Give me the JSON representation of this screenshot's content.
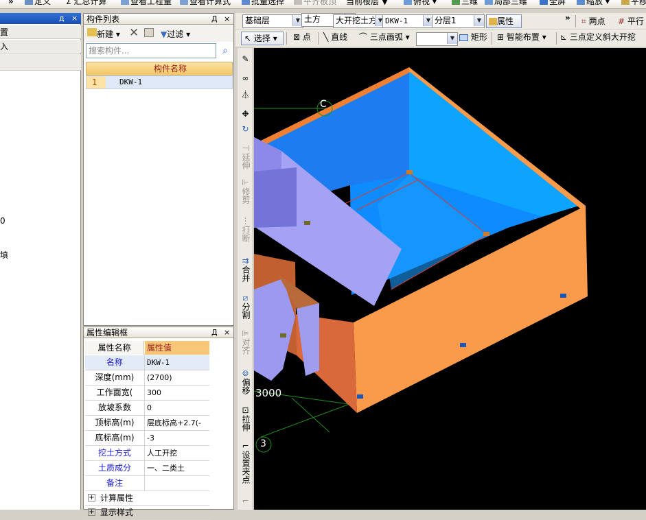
{
  "top_toolbar": {
    "items": [
      "»",
      "定义",
      "汇总计算",
      "查看工程量",
      "查看计算式",
      "批量选择",
      "平齐板顶",
      "当前楼层",
      "俯视",
      "三维",
      "局部三维",
      "全屏",
      "缩放",
      "平移"
    ]
  },
  "left_panel": {
    "items": [
      "置",
      "入",
      "0",
      "填"
    ]
  },
  "component_list": {
    "title": "构件列表",
    "pin": "Д",
    "close": "×",
    "new_label": "新建",
    "filter_label": "过滤",
    "search_placeholder": "搜索构件...",
    "column_header": "构件名称",
    "rows": [
      {
        "index": "1",
        "name": "DKW-1"
      }
    ]
  },
  "property_editor": {
    "title": "属性编辑框",
    "col_name": "属性名称",
    "col_value": "属性值",
    "rows": [
      {
        "name": "名称",
        "value": "DKW-1"
      },
      {
        "name": "深度(mm)",
        "value": "(2700)"
      },
      {
        "name": "工作面宽(",
        "value": "300"
      },
      {
        "name": "放坡系数",
        "value": "0"
      },
      {
        "name": "顶标高(m)",
        "value": "层底标高+2.7(-"
      },
      {
        "name": "底标高(m)",
        "value": "-3"
      },
      {
        "name": "挖土方式",
        "value": "人工开挖"
      },
      {
        "name": "土质成分",
        "value": "一、二类土"
      },
      {
        "name": "备注",
        "value": ""
      }
    ],
    "groups": [
      "计算属性",
      "显示样式"
    ],
    "expander": "+"
  },
  "right_toolbar1": {
    "floor": "基础层",
    "category": "土方",
    "type": "大开挖土方",
    "component": "DKW-1",
    "layer": "分层1",
    "props_button": "属性",
    "overflow": "»",
    "two_points": "两点",
    "parallel": "平行"
  },
  "right_toolbar2": {
    "select": "选择",
    "point": "点",
    "line": "直线",
    "arc": "三点画弧",
    "rect": "矩形",
    "smart_layout": "智能布置",
    "three_point_slope": "三点定义斜大开挖"
  },
  "vertical_tools": {
    "extend": "延伸",
    "trim": "修剪",
    "break": "打断",
    "merge": "合并",
    "split": "分割",
    "align": "对齐",
    "offset": "偏移",
    "stretch": "拉伸",
    "set_grip": "设置夹点"
  },
  "viewport": {
    "axis_c": "C",
    "axis_3": "3",
    "dimension": "3000"
  },
  "colors": {
    "pit_orange": "#f99b4a",
    "pit_blue": "#0a8fff",
    "accent_yellow": "#f7c676"
  }
}
